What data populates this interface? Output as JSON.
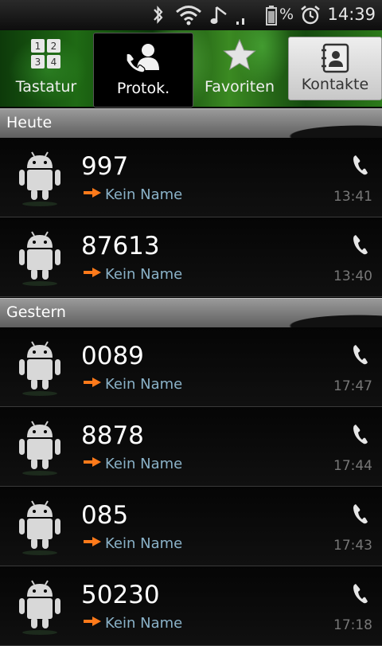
{
  "status_bar": {
    "icons": [
      "bluetooth-icon",
      "wifi-icon",
      "music-note-icon",
      "signal-icon",
      "battery-icon",
      "alarm-icon"
    ],
    "battery_percent_symbol": "%",
    "time": "14:39"
  },
  "tabs": [
    {
      "label": "Tastatur",
      "icon": "dialpad-icon",
      "keys": [
        "1",
        "2",
        "3",
        "4"
      ]
    },
    {
      "label": "Protok.",
      "icon": "call-log-icon",
      "selected": true
    },
    {
      "label": "Favoriten",
      "icon": "star-icon"
    },
    {
      "label": "Kontakte",
      "icon": "contacts-icon"
    }
  ],
  "sections": [
    {
      "header": "Heute",
      "calls": [
        {
          "number": "997",
          "name": "Kein Name",
          "time": "13:41",
          "type": "outgoing"
        },
        {
          "number": "87613",
          "name": "Kein Name",
          "time": "13:40",
          "type": "outgoing"
        }
      ]
    },
    {
      "header": "Gestern",
      "calls": [
        {
          "number": "0089",
          "name": "Kein Name",
          "time": "17:47",
          "type": "outgoing"
        },
        {
          "number": "8878",
          "name": "Kein Name",
          "time": "17:44",
          "type": "outgoing"
        },
        {
          "number": "085",
          "name": "Kein Name",
          "time": "17:43",
          "type": "outgoing"
        },
        {
          "number": "50230",
          "name": "Kein Name",
          "time": "17:18",
          "type": "outgoing"
        }
      ]
    }
  ],
  "colors": {
    "outgoing_arrow": "#ff7a1a",
    "name_text": "#8ab2c8",
    "time_text": "#777777"
  }
}
